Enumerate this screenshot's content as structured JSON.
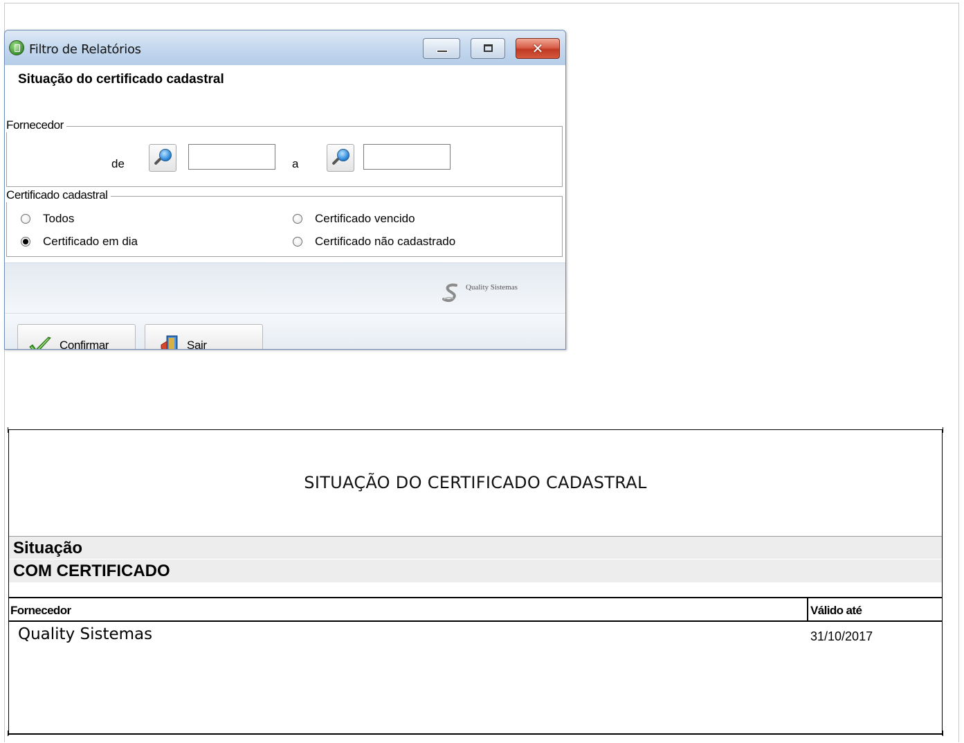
{
  "window": {
    "title": "Filtro de Relatórios",
    "close_glyph": "✕"
  },
  "dialog": {
    "heading": "Situação do certificado cadastral",
    "fornecedor_group": {
      "legend": "Fornecedor",
      "from_label": "de",
      "to_label": "a",
      "from_value": "",
      "to_value": ""
    },
    "certificado_group": {
      "legend": "Certificado cadastral",
      "options": [
        {
          "label": "Todos",
          "checked": false
        },
        {
          "label": "Certificado vencido",
          "checked": false
        },
        {
          "label": "Certificado em dia",
          "checked": true
        },
        {
          "label": "Certificado não cadastrado",
          "checked": false
        }
      ]
    },
    "logo_text": "Quality Sistemas",
    "buttons": {
      "confirm_mnemonic": "C",
      "confirm_rest": "onfirmar",
      "exit_mnemonic": "S",
      "exit_rest": "air"
    }
  },
  "report": {
    "title": "SITUAÇÃO DO CERTIFICADO CADASTRAL",
    "section_label": "Situação",
    "section_value": "COM CERTIFICADO",
    "columns": [
      "Fornecedor",
      "Válido até"
    ],
    "rows": [
      {
        "fornecedor": "Quality Sistemas",
        "valido_ate": "31/10/2017"
      }
    ]
  },
  "colors": {
    "titlebar": "#c4d8ee",
    "close_button": "#c03a22",
    "band": "#ededed"
  },
  "icons": [
    "app-icon",
    "minimize-icon",
    "maximize-icon",
    "close-icon",
    "search-icon",
    "checkmark-icon",
    "exit-door-icon",
    "quality-sistemas-logo"
  ]
}
